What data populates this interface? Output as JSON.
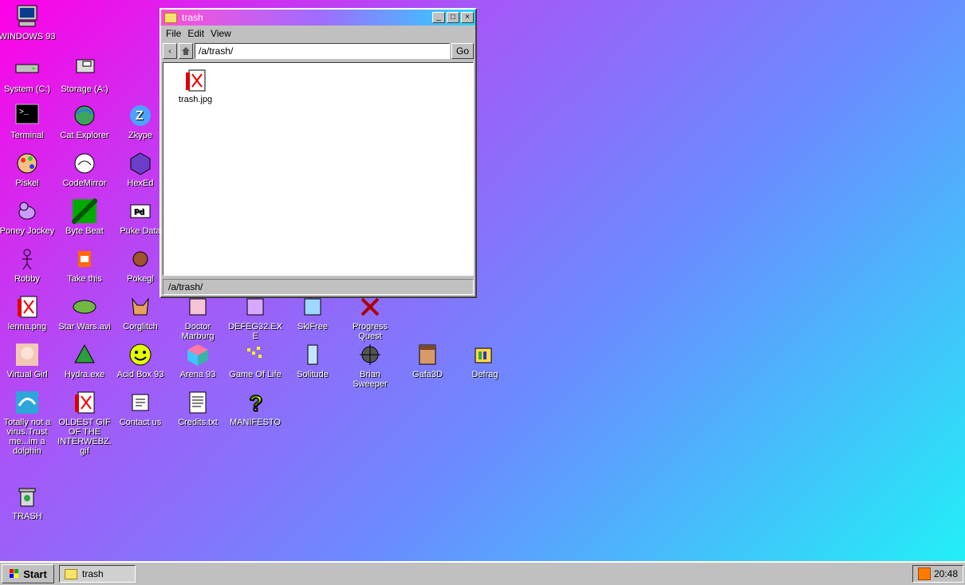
{
  "desktop_icons": [
    {
      "label": "WINDOWS 93",
      "icon": "computer-icon"
    },
    {
      "label": "System (C:)",
      "icon": "drive-icon"
    },
    {
      "label": "Storage (A:)",
      "icon": "floppy-icon"
    },
    {
      "label": "Terminal",
      "icon": "terminal-icon"
    },
    {
      "label": "Cat Explorer",
      "icon": "cat-globe-icon"
    },
    {
      "label": "Zkype",
      "icon": "zkype-icon"
    },
    {
      "label": "Piskel",
      "icon": "palette-icon"
    },
    {
      "label": "CodeMirror",
      "icon": "codemirror-icon"
    },
    {
      "label": "HexEd",
      "icon": "hexagon-icon"
    },
    {
      "label": "Poney Jockey",
      "icon": "pony-icon"
    },
    {
      "label": "Byte Beat",
      "icon": "bytebeat-icon"
    },
    {
      "label": "Puke Data",
      "icon": "puredata-icon"
    },
    {
      "label": "Robby",
      "icon": "stickman-icon"
    },
    {
      "label": "Take this",
      "icon": "clown-icon"
    },
    {
      "label": "Pokegl",
      "icon": "pokeball-icon"
    },
    {
      "label": "lenna.png",
      "icon": "image-file-icon"
    },
    {
      "label": "Star Wars.avi",
      "icon": "yoda-icon"
    },
    {
      "label": "Corglitch",
      "icon": "corgi-icon"
    },
    {
      "label": "Doctor Marburg",
      "icon": "doctor-icon"
    },
    {
      "label": "DEFEG32.EXE",
      "icon": "defeg-icon"
    },
    {
      "label": "SkiFree",
      "icon": "skier-icon"
    },
    {
      "label": "Progress Quest",
      "icon": "progress-quest-icon"
    },
    {
      "label": "Virtual Girl",
      "icon": "girl-icon"
    },
    {
      "label": "Hydra.exe",
      "icon": "dragon-icon"
    },
    {
      "label": "Acid Box 93",
      "icon": "smiley-icon"
    },
    {
      "label": "Arena 93",
      "icon": "cube-icon"
    },
    {
      "label": "Game Of Life",
      "icon": "game-of-life-icon"
    },
    {
      "label": "Solitude",
      "icon": "solitude-icon"
    },
    {
      "label": "Brian Sweeper",
      "icon": "mine-icon"
    },
    {
      "label": "Gafa3D",
      "icon": "doom-face-icon"
    },
    {
      "label": "Defrag",
      "icon": "defrag-icon"
    },
    {
      "label": "Totally not a virus.Trust me...im a dolphin",
      "icon": "dolphin-icon"
    },
    {
      "label": "OLDEST GIF OF THE INTERWEBZ.gif",
      "icon": "gif-file-icon"
    },
    {
      "label": "Contact us",
      "icon": "contact-icon"
    },
    {
      "label": "Credits.txt",
      "icon": "text-file-icon"
    },
    {
      "label": "MANIFESTO",
      "icon": "question-icon"
    },
    {
      "label": "TRASH",
      "icon": "recycle-bin-icon"
    }
  ],
  "window": {
    "title": "trash",
    "menu": [
      "File",
      "Edit",
      "View"
    ],
    "path": "/a/trash/",
    "go_label": "Go",
    "files": [
      {
        "label": "trash.jpg",
        "icon": "image-file-icon"
      }
    ],
    "status": "/a/trash/"
  },
  "taskbar": {
    "start_label": "Start",
    "task_label": "trash",
    "time": "20:48"
  },
  "colors": {
    "accent": "#a855f7",
    "gradient_start": "#ff00e6",
    "gradient_end": "#1ff3f6"
  }
}
